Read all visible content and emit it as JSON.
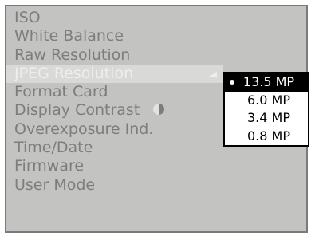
{
  "menu": {
    "items": [
      {
        "label": "ISO"
      },
      {
        "label": "White Balance"
      },
      {
        "label": "Raw Resolution"
      },
      {
        "label": "JPEG Resolution"
      },
      {
        "label": "Format Card"
      },
      {
        "label": "Display Contrast"
      },
      {
        "label": "Overexposure Ind."
      },
      {
        "label": "Time/Date"
      },
      {
        "label": "Firmware"
      },
      {
        "label": "User Mode"
      }
    ],
    "selected_index": 3
  },
  "submenu": {
    "options": [
      {
        "label": "13.5 MP"
      },
      {
        "label": "6.0 MP"
      },
      {
        "label": "3.4 MP"
      },
      {
        "label": "0.8 MP"
      }
    ],
    "current_index": 0
  },
  "icons": {
    "contrast": "contrast-half-circle-icon",
    "submenu_arrow": "arrow-right-triangle-icon",
    "bullet": "bullet-dot-icon"
  },
  "colors": {
    "panel_background": "#c3c3c1",
    "item_text": "#7d7d7b",
    "selected_background": "#d9d9d7",
    "selected_text": "#eeeeec",
    "submenu_highlight": "#000000"
  }
}
